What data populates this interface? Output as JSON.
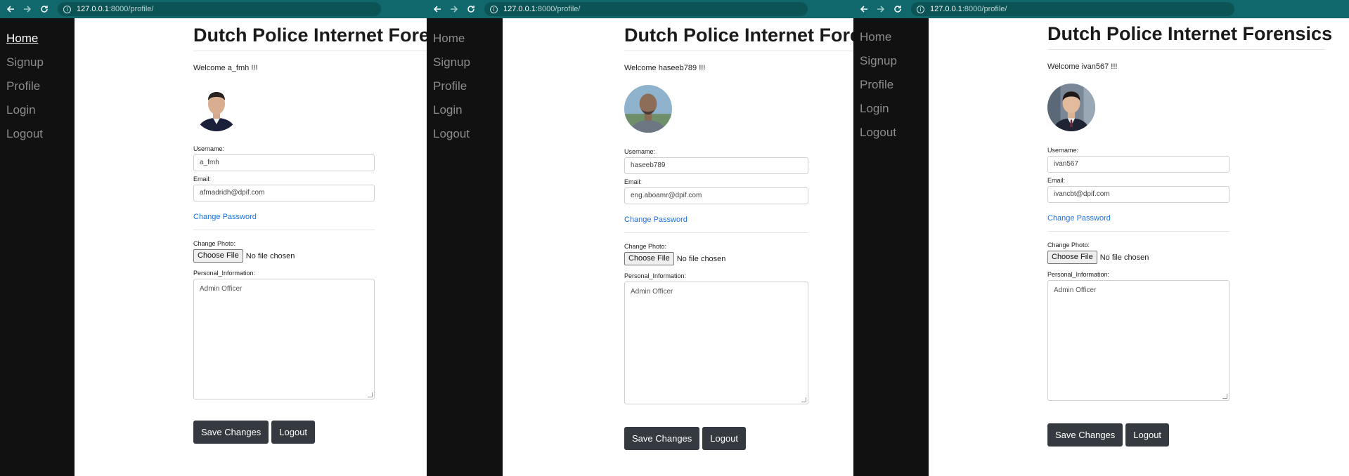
{
  "screens": [
    {
      "url_host": "127.0.0.1",
      "url_path": ":8000/profile/",
      "nav": [
        "Home",
        "Signup",
        "Profile",
        "Login",
        "Logout"
      ],
      "active_nav": 0,
      "title": "Dutch Police Internet Forensics",
      "welcome": "Welcome a_fmh !!!",
      "avatar": "avatar-man-dark-suit",
      "username_label": "Username:",
      "username": "a_fmh",
      "email_label": "Email:",
      "email": "afmadridh@dpif.com",
      "change_password": "Change Password",
      "change_photo_label": "Change Photo:",
      "choose_file": "Choose File",
      "no_file": "No file chosen",
      "personal_label": "Personal_Information:",
      "personal_info": "Admin Officer",
      "save_button": "Save Changes",
      "logout_button": "Logout"
    },
    {
      "url_host": "127.0.0.1",
      "url_path": ":8000/profile/",
      "nav": [
        "Home",
        "Signup",
        "Profile",
        "Login",
        "Logout"
      ],
      "active_nav": -1,
      "title": "Dutch Police Internet Forensics",
      "welcome": "Welcome haseeb789 !!!",
      "avatar": "avatar-man-outdoors",
      "username_label": "Username:",
      "username": "haseeb789",
      "email_label": "Email:",
      "email": "eng.aboamr@dpif.com",
      "change_password": "Change Password",
      "change_photo_label": "Change Photo:",
      "choose_file": "Choose File",
      "no_file": "No file chosen",
      "personal_label": "Personal_Information:",
      "personal_info": "Admin Officer",
      "save_button": "Save Changes",
      "logout_button": "Logout"
    },
    {
      "url_host": "127.0.0.1",
      "url_path": ":8000/profile/",
      "nav": [
        "Home",
        "Signup",
        "Profile",
        "Login",
        "Logout"
      ],
      "active_nav": -1,
      "title": "Dutch Police Internet Forensics",
      "welcome": "Welcome ivan567 !!!",
      "avatar": "avatar-man-suit-tie",
      "username_label": "Username:",
      "username": "ivan567",
      "email_label": "Email:",
      "email": "ivancbt@dpif.com",
      "change_password": "Change Password",
      "change_photo_label": "Change Photo:",
      "choose_file": "Choose File",
      "no_file": "No file chosen",
      "personal_label": "Personal_Information:",
      "personal_info": "Admin Officer",
      "save_button": "Save Changes",
      "logout_button": "Logout"
    }
  ],
  "colors": {
    "browser_bar": "#10686c",
    "sidebar": "#111111",
    "button": "#343a40",
    "link": "#1b73e8"
  }
}
